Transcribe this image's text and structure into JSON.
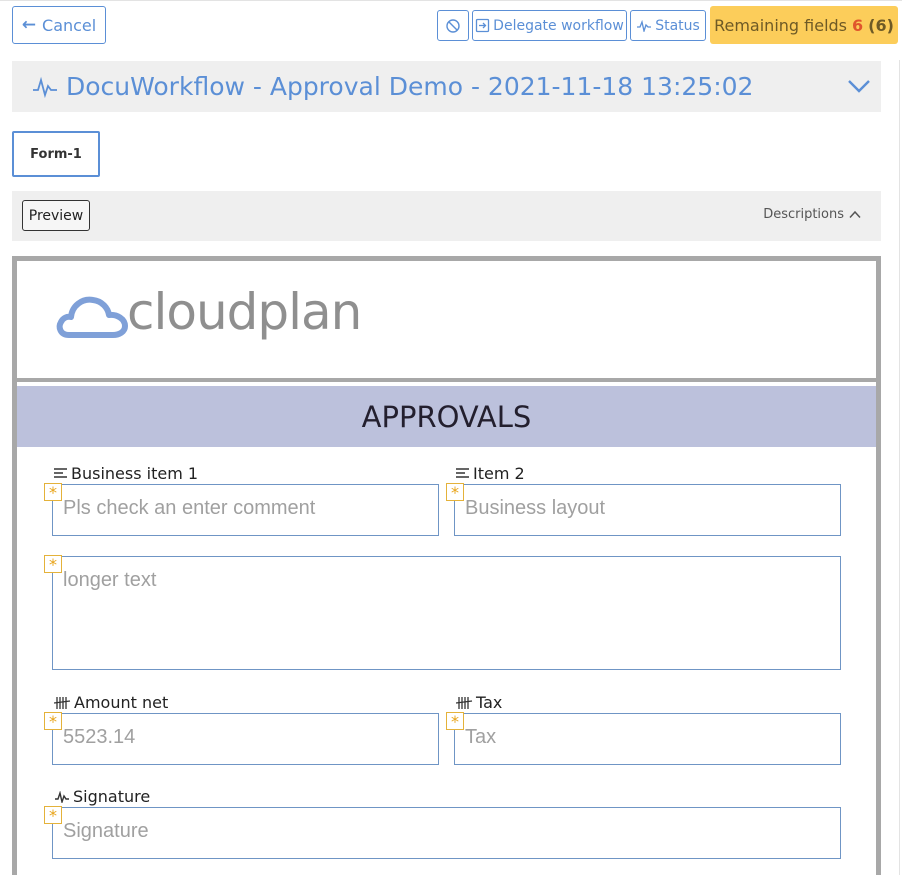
{
  "toolbar": {
    "cancel_label": "Cancel",
    "delegate_label": "Delegate workflow",
    "status_label": "Status",
    "remaining_label": "Remaining fields",
    "remaining_count": "6",
    "remaining_total": "(6)"
  },
  "header": {
    "title": "DocuWorkflow - Approval Demo - 2021-11-18 13:25:02"
  },
  "tabs": [
    {
      "label": "Form-1"
    }
  ],
  "preview_bar": {
    "preview_label": "Preview",
    "descriptions_label": "Descriptions"
  },
  "document": {
    "logo_text": "cloudplan",
    "section_title": "APPROVALS",
    "fields": {
      "business_item_1": {
        "label": "Business item 1",
        "placeholder": "Pls check an enter comment"
      },
      "item_2": {
        "label": "Item 2",
        "placeholder": "Business layout"
      },
      "longer_text": {
        "placeholder": "longer text"
      },
      "amount_net": {
        "label": "Amount net",
        "value": "5523.14"
      },
      "tax": {
        "label": "Tax",
        "placeholder": "Tax"
      },
      "signature": {
        "label": "Signature",
        "placeholder": "Signature"
      }
    },
    "required_marker": "*"
  },
  "colors": {
    "accent": "#5b8fd6",
    "remaining_bg": "#fccd5a",
    "remaining_count": "#e0552c",
    "section_bg": "#bcc1dc",
    "field_border": "#6f95c5",
    "required_marker": "#e8a317"
  },
  "icons": {
    "cancel": "arrow-left-icon",
    "block": "block-icon",
    "delegate": "delegate-icon",
    "status": "signal-icon",
    "workflow": "signature-wave-icon",
    "expand": "chevron-down-icon",
    "collapse": "chevron-up-icon",
    "text_field": "text-lines-icon",
    "number_field": "tally-icon",
    "signature_field": "signature-wave-icon"
  }
}
